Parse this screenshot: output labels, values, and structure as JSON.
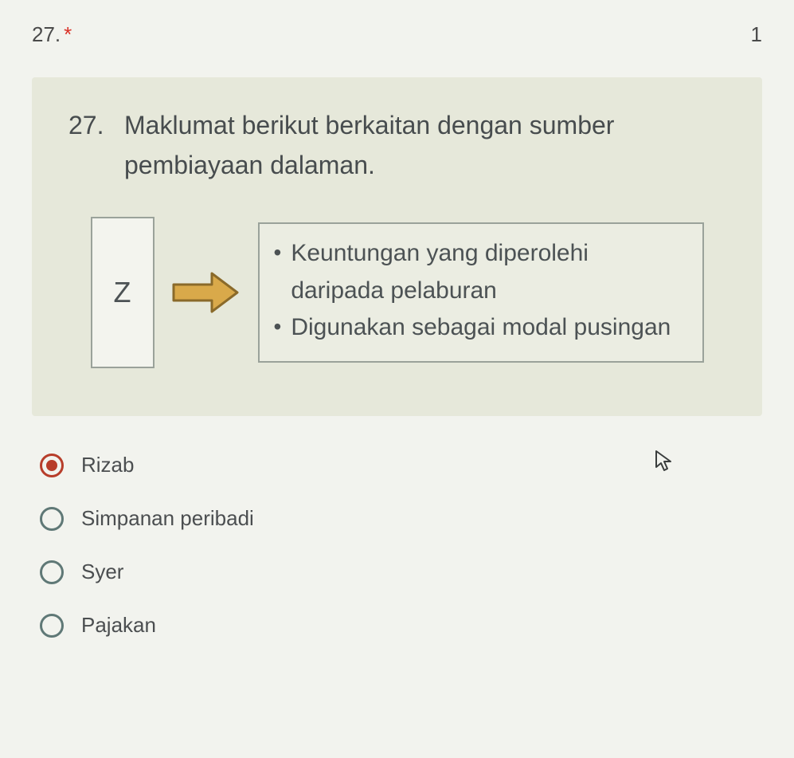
{
  "header": {
    "number": "27.",
    "required_mark": "*",
    "right_fragment": "1"
  },
  "question": {
    "number": "27.",
    "text": "Maklumat berikut berkaitan dengan sumber pembiayaan dalaman."
  },
  "diagram": {
    "box_label": "Z",
    "descriptions": [
      "Keuntungan yang diperolehi daripada pelaburan",
      "Digunakan sebagai modal pusingan"
    ]
  },
  "options": [
    {
      "label": "Rizab",
      "selected": true
    },
    {
      "label": "Simpanan peribadi",
      "selected": false
    },
    {
      "label": "Syer",
      "selected": false
    },
    {
      "label": "Pajakan",
      "selected": false
    }
  ]
}
